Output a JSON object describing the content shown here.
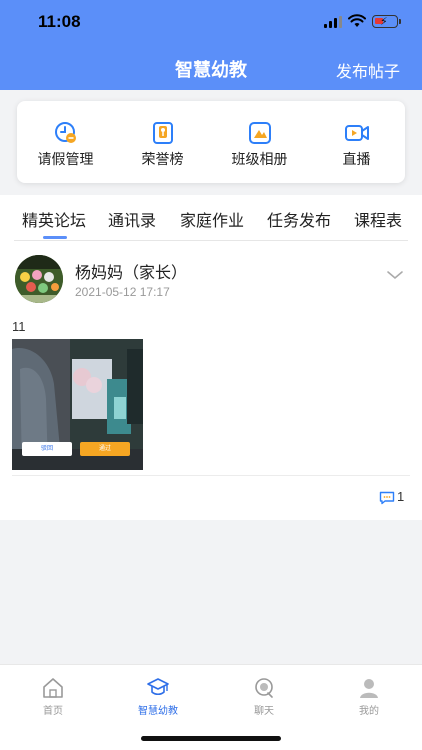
{
  "status": {
    "time": "11:08"
  },
  "nav": {
    "title": "智慧幼教",
    "action": "发布帖子"
  },
  "quick_actions": [
    {
      "label": "请假管理",
      "icon": "leave-clock-icon"
    },
    {
      "label": "荣誉榜",
      "icon": "honor-badge-icon"
    },
    {
      "label": "班级相册",
      "icon": "album-icon"
    },
    {
      "label": "直播",
      "icon": "live-video-icon"
    }
  ],
  "tabs": [
    {
      "label": "精英论坛",
      "active": true
    },
    {
      "label": "通讯录"
    },
    {
      "label": "家庭作业"
    },
    {
      "label": "任务发布"
    },
    {
      "label": "课程表"
    }
  ],
  "post": {
    "author": "杨妈妈（家长）",
    "time": "2021-05-12 17:17",
    "text": "11",
    "photo_buttons": [
      "驳回",
      "通过"
    ],
    "comment_count": "1"
  },
  "tabbar": [
    {
      "label": "首页",
      "icon": "home-icon"
    },
    {
      "label": "智慧幼教",
      "icon": "graduation-cap-icon",
      "active": true
    },
    {
      "label": "聊天",
      "icon": "chat-icon"
    },
    {
      "label": "我的",
      "icon": "profile-icon"
    }
  ],
  "colors": {
    "brand": "#5b8ff9",
    "accent": "#2f6fe8",
    "approve": "#f5a623"
  }
}
